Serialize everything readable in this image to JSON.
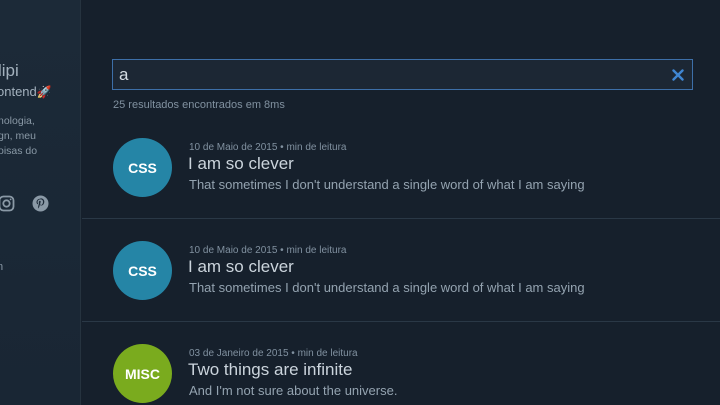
{
  "sidebar": {
    "name": "lipi",
    "role": "ontend",
    "role_emoji": "🚀",
    "description": [
      "nologia,",
      "gn, meu",
      "oisas do"
    ],
    "socials": [
      "instagram-icon",
      "pinterest-icon"
    ],
    "link": "n"
  },
  "search": {
    "value": "a",
    "placeholder": ""
  },
  "results_count": "25 resultados encontrados em 8ms",
  "posts": [
    {
      "tag": "CSS",
      "tag_color": "#2585a6",
      "date": "10 de Maio de 2015",
      "read_time": "min de leitura",
      "title": "I am so clever",
      "description": "That sometimes I don't understand a single word of what I am saying"
    },
    {
      "tag": "CSS",
      "tag_color": "#2585a6",
      "date": "10 de Maio de 2015",
      "read_time": "min de leitura",
      "title": "I am so clever",
      "description": "That sometimes I don't understand a single word of what I am saying"
    },
    {
      "tag": "MISC",
      "tag_color": "#7aab1e",
      "date": "03 de Janeiro de 2015",
      "read_time": "min de leitura",
      "title": "Two things are infinite",
      "description": "And I'm not sure about the universe."
    }
  ]
}
